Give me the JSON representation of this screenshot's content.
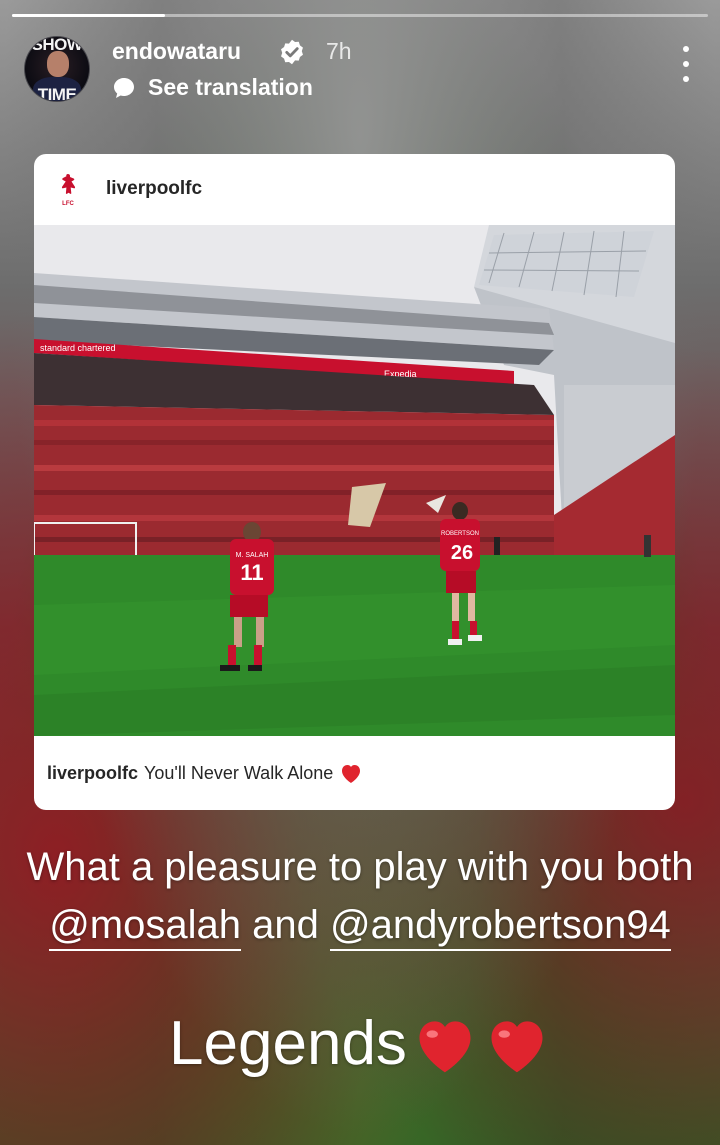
{
  "story": {
    "progress": 0.22,
    "username": "endowataru",
    "verified": true,
    "time_ago": "7h",
    "translate_label": "See translation",
    "avatar_text_top": "SHOW",
    "avatar_text_bottom": "TIME"
  },
  "shared_post": {
    "account": "liverpoolfc",
    "caption_user": "liverpoolfc",
    "caption_text": "You'll Never Walk Alone",
    "photo": {
      "banner_text": "standard chartered",
      "sponsor_text": "Expedia",
      "player_left_name": "M. SALAH",
      "player_left_number": "11",
      "player_right_name": "ROBERTSON",
      "player_right_number": "26"
    }
  },
  "story_text": {
    "line1": "What a pleasure to play with you both",
    "mention1": "@mosalah",
    "connector": "and",
    "mention2": "@andyrobertson94",
    "legends": "Legends"
  },
  "colors": {
    "liverpool_red": "#c8102e",
    "heart_red": "#e0242e",
    "pitch_green": "#2f8a2a"
  }
}
